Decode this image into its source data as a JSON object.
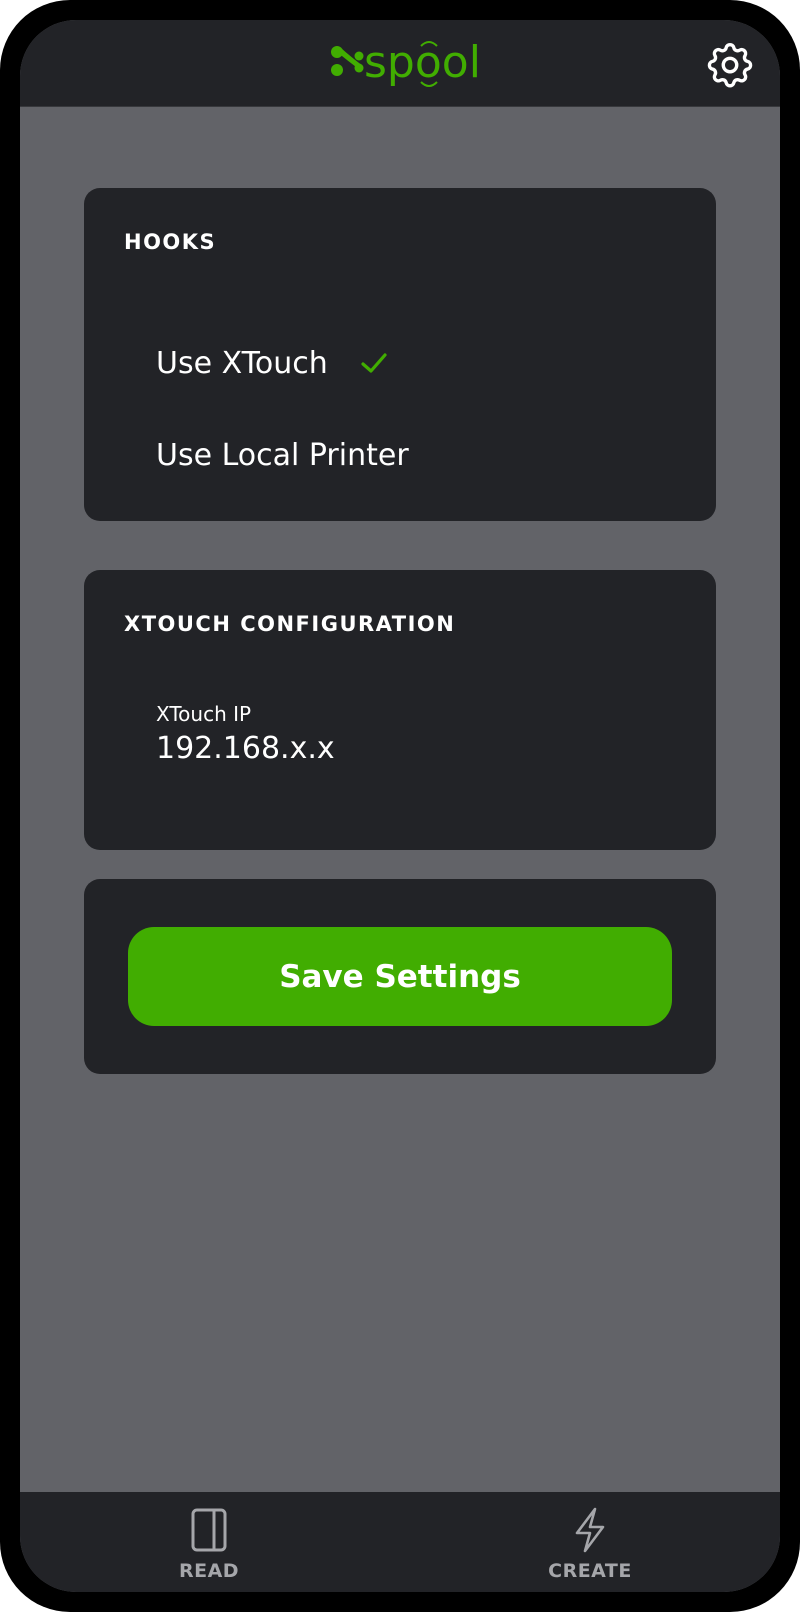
{
  "app": {
    "name": "xspool",
    "brand_color": "#41ad01",
    "icons": {
      "logo": "xspool-logo",
      "settings": "gear-icon"
    }
  },
  "hooks": {
    "title": "HOOKS",
    "options": [
      {
        "label": "Use XTouch",
        "checked": true
      },
      {
        "label": "Use Local Printer",
        "checked": false
      }
    ]
  },
  "xtouch_config": {
    "title": "XTOUCH CONFIGURATION",
    "field_label": "XTouch IP",
    "field_placeholder": "192.168.x.x"
  },
  "save": {
    "label": "Save Settings"
  },
  "tabbar": {
    "items": [
      {
        "label": "READ",
        "icon": "card-icon"
      },
      {
        "label": "CREATE",
        "icon": "bolt-icon"
      }
    ]
  }
}
